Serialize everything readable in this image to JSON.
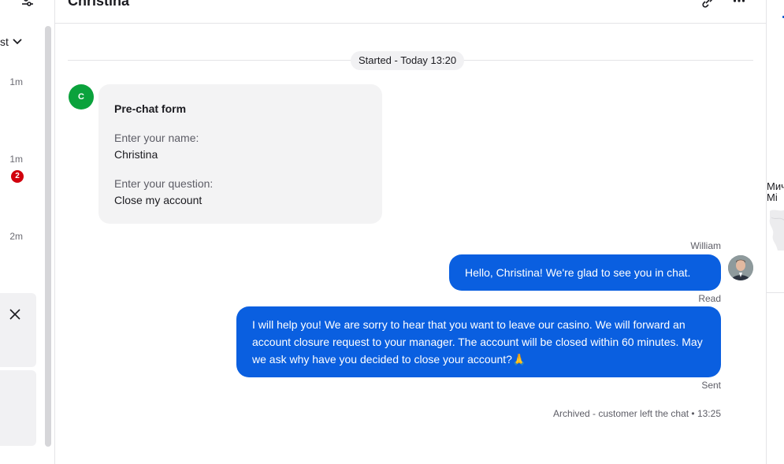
{
  "sidebar": {
    "sort_label": "st",
    "items": [
      {
        "time": "1m"
      },
      {
        "time": "1m",
        "badge": "2"
      },
      {
        "time": "2m"
      }
    ]
  },
  "header": {
    "title": "Christina"
  },
  "chat": {
    "started": "Started - Today 13:20",
    "customer_initial": "C",
    "prechat": {
      "title": "Pre-chat form",
      "q1": "Enter your name:",
      "a1": "Christina",
      "q2": "Enter your question:",
      "a2": "Close my account"
    },
    "agent_name": "William",
    "messages": [
      {
        "text": "Hello, Christina! We're glad to see you in chat.",
        "status": "Read"
      },
      {
        "text": "I will help you! We are sorry to hear that you want to leave our casino. We will forward an account closure request to your manager. The account will be closed within 60 minutes. May we ask why have you decided to close your account?🙏",
        "status": "Sent"
      }
    ],
    "archived": "Archived - customer left the chat • 13:25"
  },
  "right_panel": {
    "line1": "Мич",
    "line2": "Mi"
  },
  "colors": {
    "accent": "#0a5fe0",
    "customer_avatar": "#0ba23c",
    "badge": "#d1000d"
  }
}
